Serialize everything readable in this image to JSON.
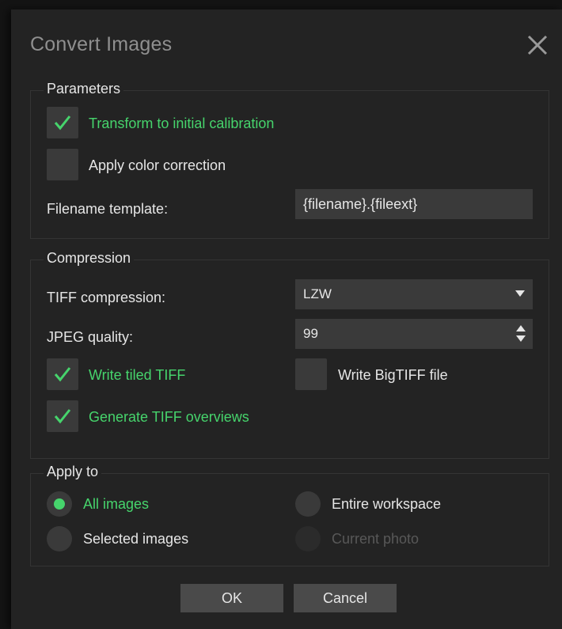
{
  "dialog": {
    "title": "Convert Images"
  },
  "parameters": {
    "label": "Parameters",
    "transform": {
      "label": "Transform to initial calibration",
      "checked": true
    },
    "color_correction": {
      "label": "Apply color correction",
      "checked": false
    },
    "filename_template": {
      "label": "Filename template:",
      "value": "{filename}.{fileext}"
    }
  },
  "compression": {
    "label": "Compression",
    "tiff_compression": {
      "label": "TIFF compression:",
      "value": "LZW"
    },
    "jpeg_quality": {
      "label": "JPEG quality:",
      "value": "99"
    },
    "tiled_tiff": {
      "label": "Write tiled TIFF",
      "checked": true
    },
    "bigtiff": {
      "label": "Write BigTIFF file",
      "checked": false
    },
    "overviews": {
      "label": "Generate TIFF overviews",
      "checked": true
    }
  },
  "apply_to": {
    "label": "Apply to",
    "options": [
      {
        "label": "All images",
        "selected": true,
        "enabled": true
      },
      {
        "label": "Selected images",
        "selected": false,
        "enabled": true
      },
      {
        "label": "Entire workspace",
        "selected": false,
        "enabled": true
      },
      {
        "label": "Current photo",
        "selected": false,
        "enabled": false
      }
    ]
  },
  "buttons": {
    "ok": "OK",
    "cancel": "Cancel"
  },
  "colors": {
    "accent_green": "#46d46c",
    "background": "#232323",
    "control": "#3a3a3a"
  }
}
